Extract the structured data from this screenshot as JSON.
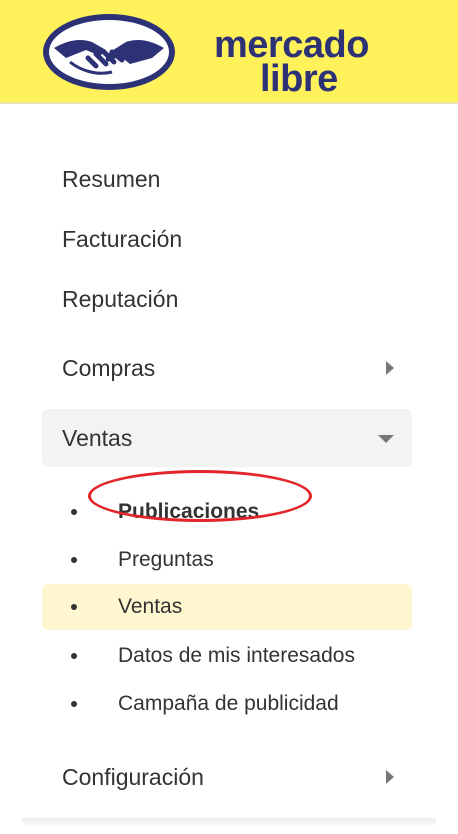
{
  "header": {
    "brand_line1": "mercado",
    "brand_line2": "libre",
    "logo_icon": "handshake-icon",
    "colors": {
      "background": "#fff159",
      "logo": "#2d3277"
    }
  },
  "menu": {
    "items": [
      {
        "label": "Resumen"
      },
      {
        "label": "Facturación"
      },
      {
        "label": "Reputación"
      },
      {
        "label": "Compras",
        "icon": "chevron-right-icon"
      },
      {
        "label": "Ventas",
        "icon": "chevron-down-icon",
        "expanded": true
      }
    ],
    "ventas_sub": [
      {
        "label": "Publicaciones",
        "bold": true,
        "annotated": true
      },
      {
        "label": "Preguntas"
      },
      {
        "label": "Ventas",
        "selected": true
      },
      {
        "label": "Datos de mis interesados"
      },
      {
        "label": "Campaña de publicidad"
      }
    ],
    "configuracion": {
      "label": "Configuración",
      "icon": "chevron-right-icon"
    }
  }
}
